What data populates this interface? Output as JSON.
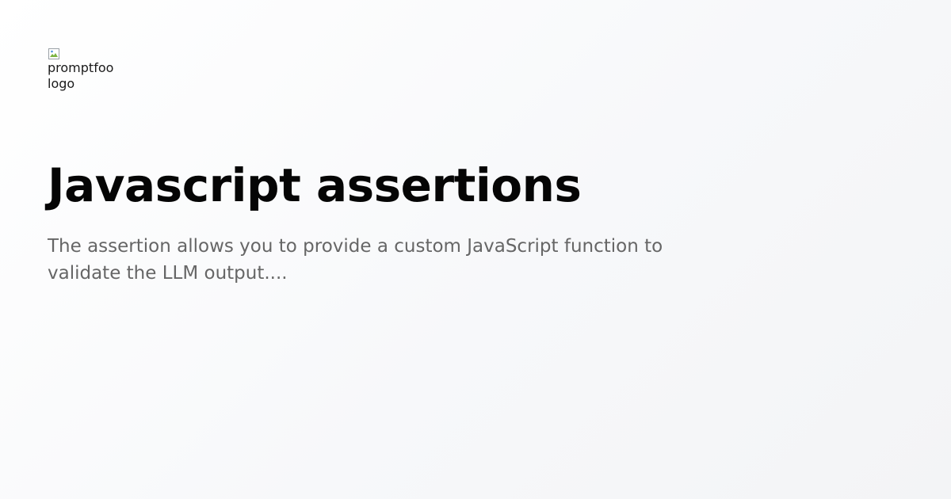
{
  "logo": {
    "alt_text": "promptfoo logo",
    "icon": "broken-image-icon"
  },
  "page": {
    "title": "Javascript assertions",
    "description": "The assertion allows you to provide a custom JavaScript function to validate the LLM output...."
  },
  "colors": {
    "title": "#050505",
    "description": "#666666",
    "background_start": "#ffffff",
    "background_end": "#f3f4f6"
  }
}
